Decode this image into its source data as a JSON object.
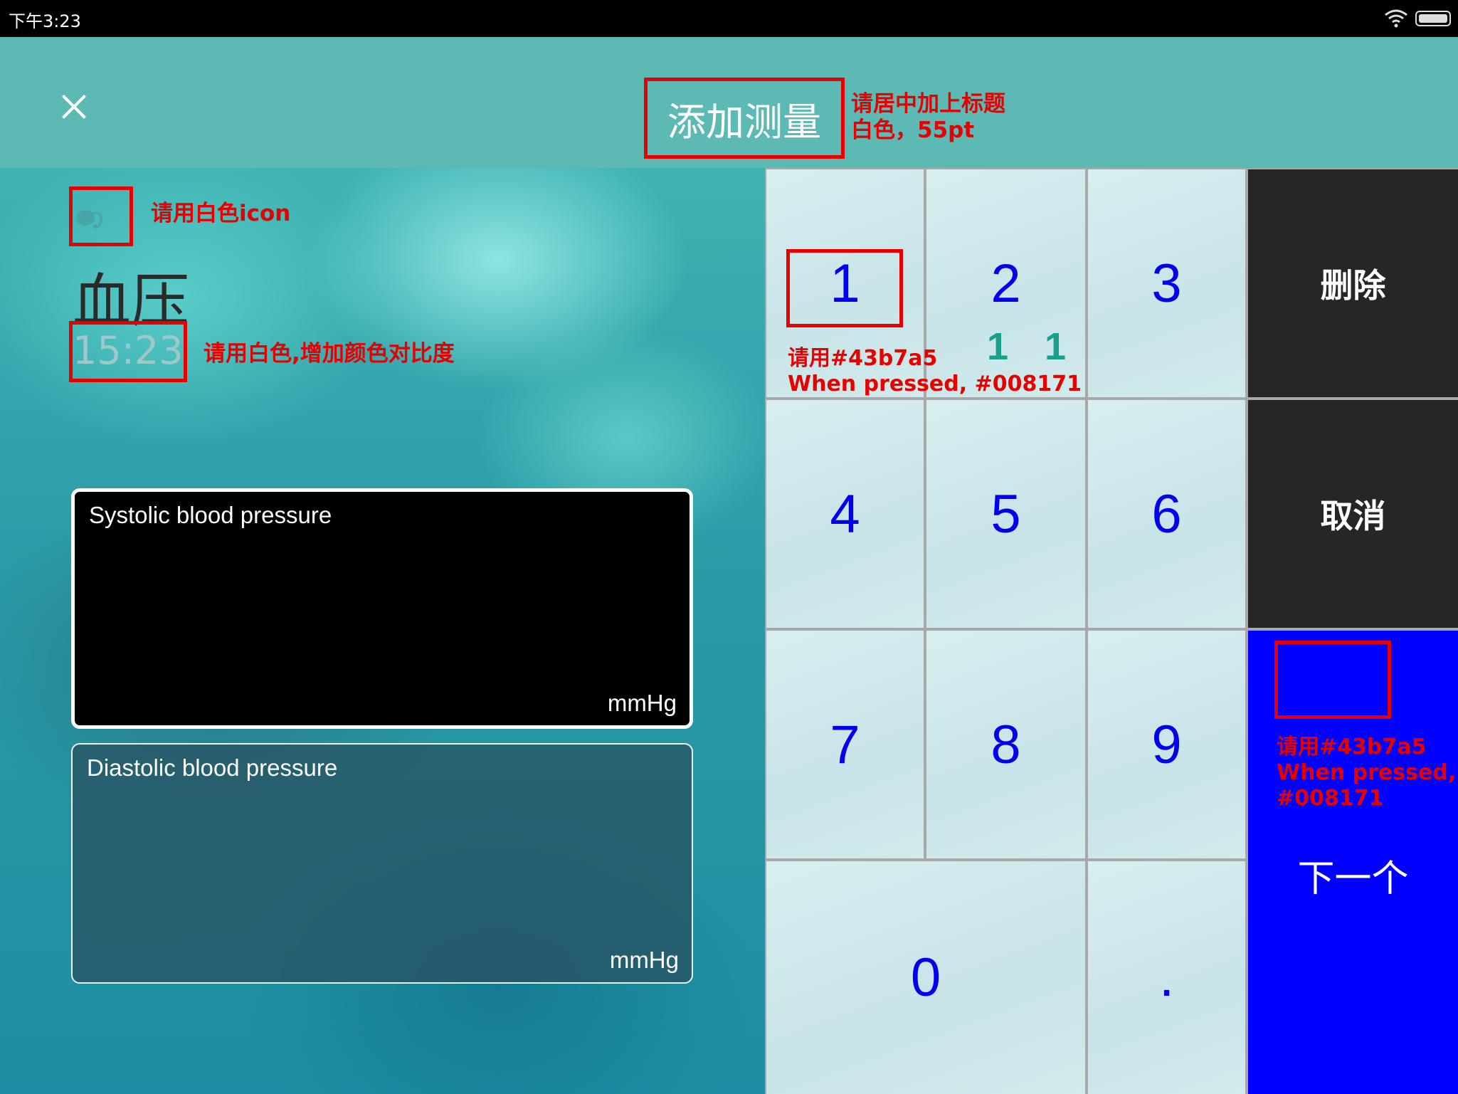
{
  "status_bar": {
    "time": "下午3:23"
  },
  "header": {
    "title": "添加测量"
  },
  "annotations": {
    "title_note_line1": "请居中加上标题",
    "title_note_line2": "白色，55pt",
    "icon_note": "请用白色icon",
    "time_note": "请用白色,增加颜色对比度",
    "key_note_line1": "请用#43b7a5",
    "key_note_line2": "When pressed, #008171",
    "key_marks": "1 1",
    "next_note_line1": "请用#43b7a5",
    "next_note_line2": "When pressed,",
    "next_note_line3": "#008171"
  },
  "measurement": {
    "icon": "blood-pressure-icon",
    "title": "血压",
    "time": "15:23"
  },
  "fields": {
    "systolic_label": "Systolic blood pressure",
    "systolic_unit": "mmHg",
    "diastolic_label": "Diastolic blood pressure",
    "diastolic_unit": "mmHg"
  },
  "keypad": {
    "k1": "1",
    "k2": "2",
    "k3": "3",
    "k4": "4",
    "k5": "5",
    "k6": "6",
    "k7": "7",
    "k8": "8",
    "k9": "9",
    "k0": "0",
    "kdot": ".",
    "delete": "删除",
    "cancel": "取消",
    "next": "下一个"
  },
  "colors": {
    "header_bg": "#5cb9b3",
    "key_text": "#0000ee",
    "next_bg": "#0000ff",
    "dark_key_bg": "#262626",
    "annotation": "#e60000"
  }
}
